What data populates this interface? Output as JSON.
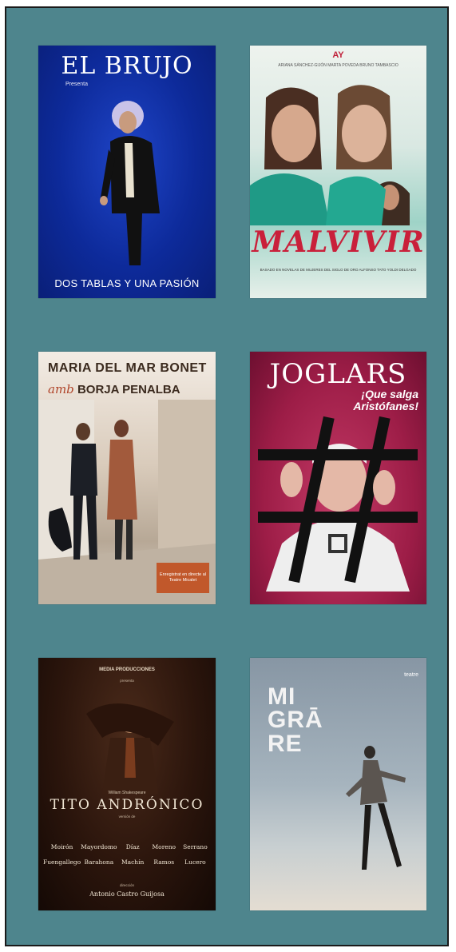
{
  "posters": [
    {
      "title": "EL BRUJO",
      "subtitle": "Presenta",
      "tagline": "DOS TABLAS Y UNA PASIÓN"
    },
    {
      "logo": "AY",
      "names": "ARIANA SÁNCHEZ-GIJÓN   MARTA POVEDA   BRUNO TAMBASCIO",
      "title": "MALVIVIR",
      "credits": "BASADO EN NOVELAS DE MUJERES DEL SIGLO DE ORO   ALFONSO TATO   YOLDI DELGADO"
    },
    {
      "name1": "MARIA DEL MAR BONET",
      "connector": "amb",
      "name2": "BORJA PENALBA",
      "badge": "Enregistrat en directe al Teatre Micalet"
    },
    {
      "title": "JOGLARS",
      "subtitle_line1": "¡Que salga",
      "subtitle_line2": "Aristófanes!"
    },
    {
      "logo": "MEDIA PRODUCCIONES",
      "producer": "presenta",
      "author": "William Shakespeare",
      "title": "TITO ANDRÓNICO",
      "version": "versión de",
      "cast": [
        "Moirón",
        "Mayordomo",
        "Díaz",
        "Moreno",
        "Serrano",
        "Fuengallego",
        "Barahona",
        "Machín",
        "Ramos",
        "Lucero"
      ],
      "direction_label": "dirección",
      "director": "Antonio Castro Guijosa"
    },
    {
      "logo": "teatre",
      "title_line1": "MI",
      "title_line2": "GRĀ",
      "title_line3": "RE"
    }
  ]
}
